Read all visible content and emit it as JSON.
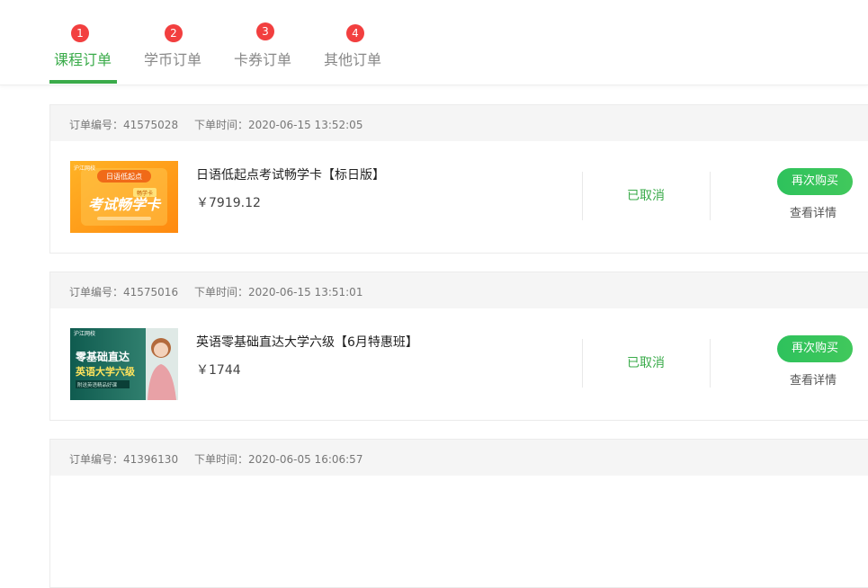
{
  "tabs": [
    {
      "badge": "1",
      "label": "课程订单",
      "active": true
    },
    {
      "badge": "2",
      "label": "学币订单",
      "active": false
    },
    {
      "badge": "3",
      "label": "卡券订单",
      "active": false
    },
    {
      "badge": "4",
      "label": "其他订单",
      "active": false
    }
  ],
  "orders": [
    {
      "order_no": "订单编号：41575028",
      "order_time": "下单时间：2020-06-15 13:52:05",
      "title": "日语低起点考试畅学卡【标日版】",
      "price": "￥7919.12",
      "status": "已取消",
      "rebuy_label": "再次购买",
      "detail_label": "查看详情",
      "thumb": {
        "brand": "沪江网校",
        "banner": "日语低起点",
        "tag": "畅学卡",
        "main": "考试畅学卡"
      }
    },
    {
      "order_no": "订单编号：41575016",
      "order_time": "下单时间：2020-06-15 13:51:01",
      "title": "英语零基础直达大学六级【6月特惠班】",
      "price": "￥1744",
      "status": "已取消",
      "rebuy_label": "再次购买",
      "detail_label": "查看详情",
      "thumb": {
        "brand": "沪江网校",
        "line1": "零基础直达",
        "line2": "英语大学六级",
        "tag": "附送英语精品好课"
      }
    },
    {
      "order_no": "订单编号：41396130",
      "order_time": "下单时间：2020-06-05 16:06:57"
    }
  ]
}
